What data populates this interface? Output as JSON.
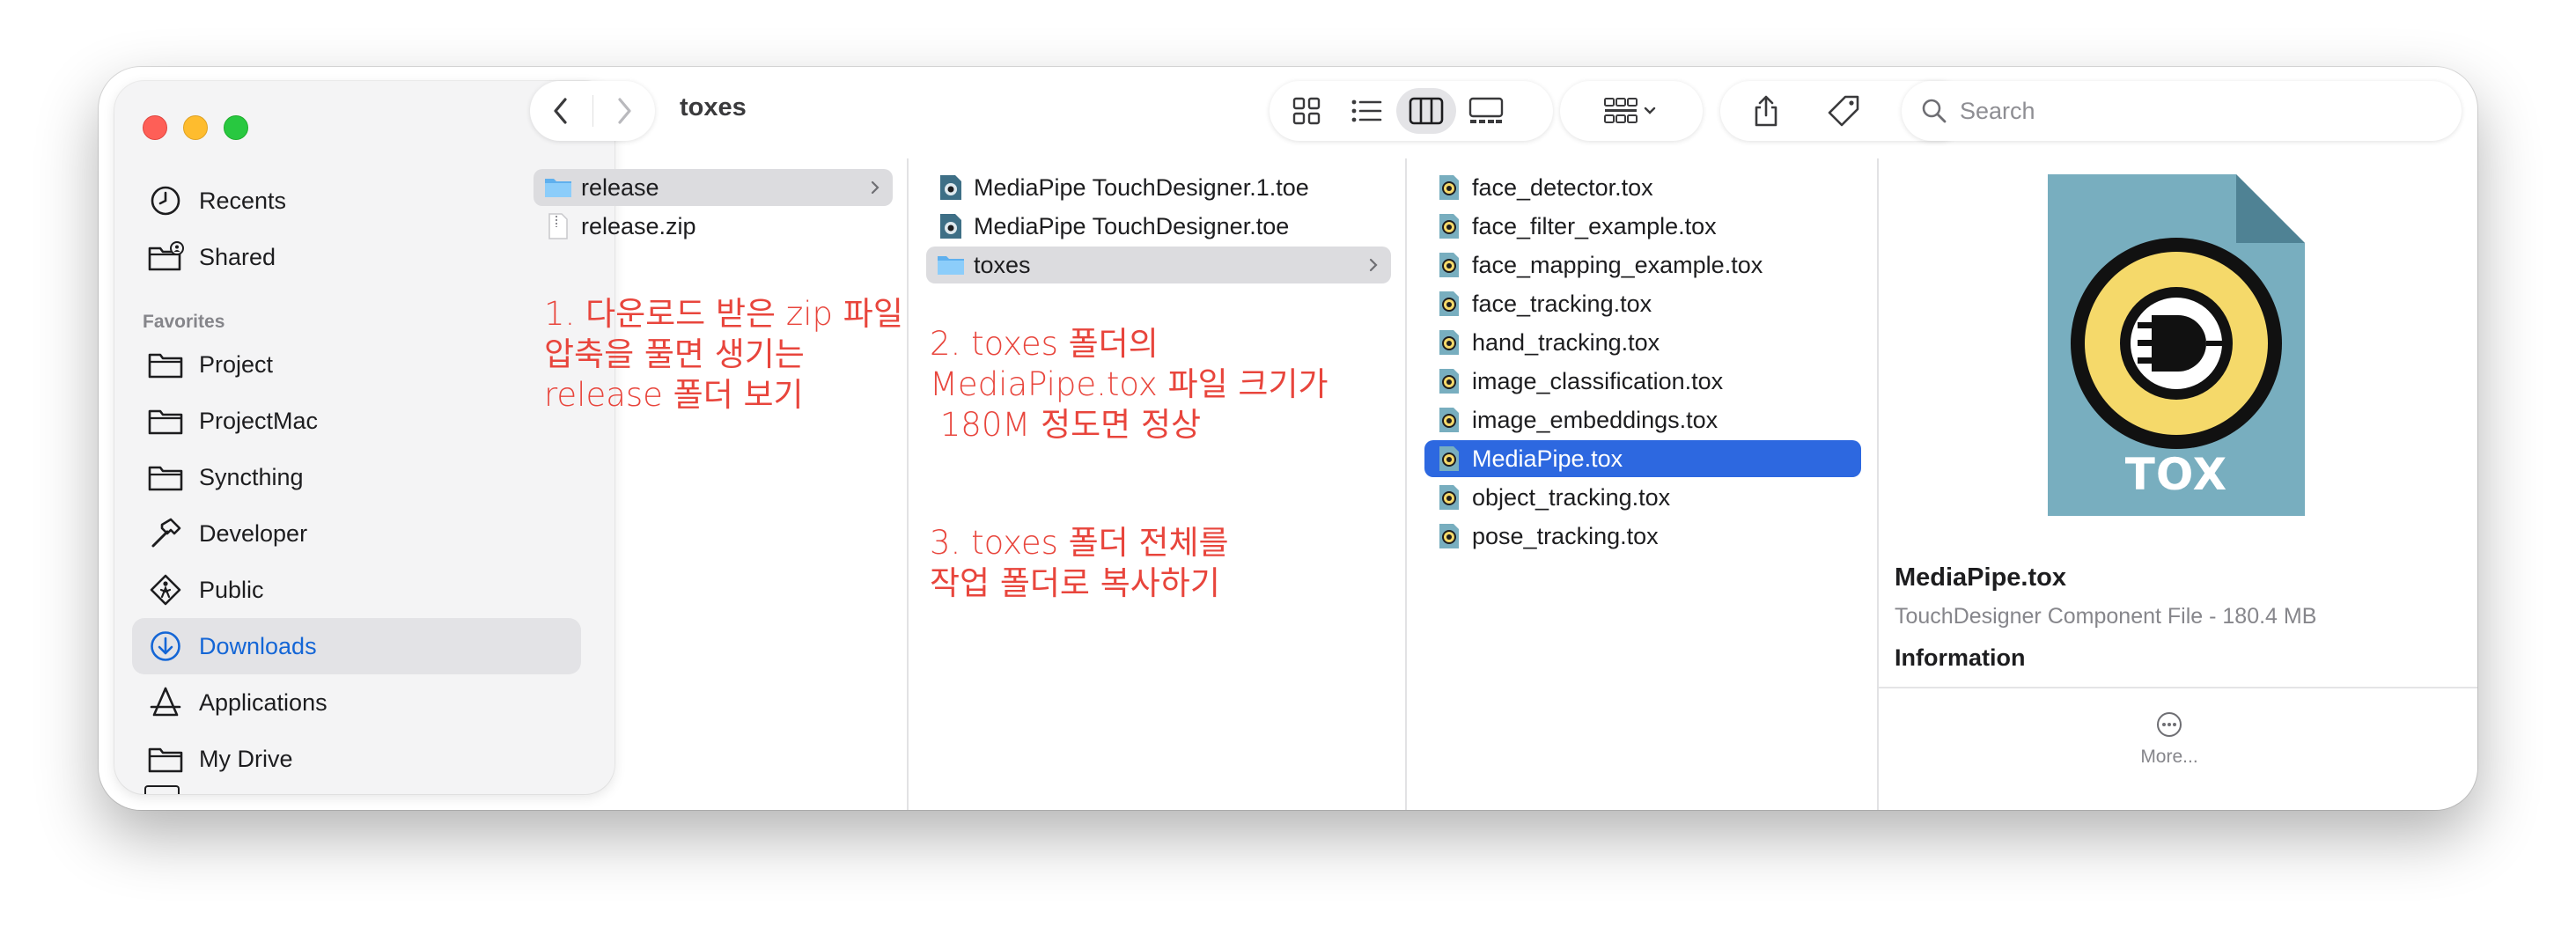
{
  "toolbar": {
    "title": "toxes",
    "search_placeholder": "Search"
  },
  "sidebar": {
    "items_top": [
      {
        "label": "Recents",
        "icon": "clock-icon"
      },
      {
        "label": "Shared",
        "icon": "shared-folder-icon"
      }
    ],
    "favorites_heading": "Favorites",
    "favorites": [
      {
        "label": "Project",
        "icon": "folder-icon"
      },
      {
        "label": "ProjectMac",
        "icon": "folder-icon"
      },
      {
        "label": "Syncthing",
        "icon": "folder-icon"
      },
      {
        "label": "Developer",
        "icon": "hammer-icon"
      },
      {
        "label": "Public",
        "icon": "public-icon"
      },
      {
        "label": "Downloads",
        "icon": "download-icon",
        "selected": true
      },
      {
        "label": "Applications",
        "icon": "applications-icon"
      },
      {
        "label": "My Drive",
        "icon": "folder-icon"
      }
    ]
  },
  "columns": {
    "col1": [
      {
        "name": "release",
        "kind": "folder",
        "selected": true
      },
      {
        "name": "release.zip",
        "kind": "zip"
      }
    ],
    "col2": [
      {
        "name": "MediaPipe TouchDesigner.1.toe",
        "kind": "toe"
      },
      {
        "name": "MediaPipe TouchDesigner.toe",
        "kind": "toe"
      },
      {
        "name": "toxes",
        "kind": "folder",
        "selected": true
      }
    ],
    "col3": [
      {
        "name": "face_detector.tox"
      },
      {
        "name": "face_filter_example.tox"
      },
      {
        "name": "face_mapping_example.tox"
      },
      {
        "name": "face_tracking.tox"
      },
      {
        "name": "hand_tracking.tox"
      },
      {
        "name": "image_classification.tox"
      },
      {
        "name": "image_embeddings.tox"
      },
      {
        "name": "MediaPipe.tox",
        "selected": true
      },
      {
        "name": "object_tracking.tox"
      },
      {
        "name": "pose_tracking.tox"
      }
    ]
  },
  "annotations": {
    "note1": "1. 다운로드 받은 zip 파일\n압축을 풀면 생기는\nrelease 폴더 보기",
    "note2": "2. toxes 폴더의\nMediaPipe.tox 파일 크기가\n 180M 정도면 정상",
    "note3": "3. toxes 폴더 전체를\n작업 폴더로 복사하기"
  },
  "preview": {
    "icon_label": "TOX",
    "file_name": "MediaPipe.tox",
    "file_kind": "TouchDesigner Component File - 180.4 MB",
    "info_heading": "Information",
    "more_label": "More..."
  },
  "colors": {
    "accent": "#2d68e0",
    "annotation": "#e8453c",
    "tox_icon_body": "#78aebf",
    "tox_icon_yellow": "#f5d96a"
  }
}
